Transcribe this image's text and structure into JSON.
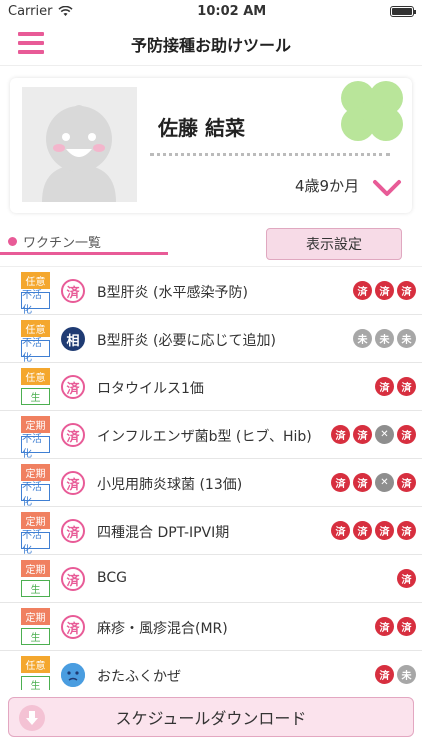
{
  "status": {
    "carrier": "Carrier",
    "time": "10:02 AM"
  },
  "nav": {
    "title": "予防接種お助けツール"
  },
  "profile": {
    "name": "佐藤 結菜",
    "age": "4歳9か月"
  },
  "section": {
    "label": "ワクチン一覧",
    "display_settings": "表示設定"
  },
  "vaccines": [
    {
      "tag1": "任意",
      "tag1_style": "orange",
      "tag2": "不活化",
      "tag2_style": "blue",
      "icon": "done-stamp-icon",
      "icon_glyph": "済",
      "icon_style": "pink",
      "name": "B型肝炎 (水平感染予防)",
      "doses": [
        {
          "text": "済",
          "state": "done"
        },
        {
          "text": "済",
          "state": "done"
        },
        {
          "text": "済",
          "state": "done"
        }
      ]
    },
    {
      "tag1": "任意",
      "tag1_style": "orange",
      "tag2": "不活化",
      "tag2_style": "blue",
      "icon": "consult-icon",
      "icon_glyph": "相",
      "icon_style": "navy",
      "name": "B型肝炎 (必要に応じて追加)",
      "doses": [
        {
          "text": "未",
          "state": "not"
        },
        {
          "text": "未",
          "state": "not"
        },
        {
          "text": "未",
          "state": "not"
        }
      ]
    },
    {
      "tag1": "任意",
      "tag1_style": "orange",
      "tag2": "生",
      "tag2_style": "green",
      "icon": "done-stamp-icon",
      "icon_glyph": "済",
      "icon_style": "pink",
      "name": "ロタウイルス1価",
      "doses": [
        {
          "text": "済",
          "state": "done"
        },
        {
          "text": "済",
          "state": "done"
        }
      ]
    },
    {
      "tag1": "定期",
      "tag1_style": "salmon",
      "tag2": "不活化",
      "tag2_style": "blue",
      "icon": "done-stamp-icon",
      "icon_glyph": "済",
      "icon_style": "pink",
      "name": "インフルエンザ菌b型 (ヒブ、Hib)",
      "doses": [
        {
          "text": "済",
          "state": "done"
        },
        {
          "text": "済",
          "state": "done"
        },
        {
          "text": "✕",
          "state": "x"
        },
        {
          "text": "済",
          "state": "done"
        }
      ]
    },
    {
      "tag1": "定期",
      "tag1_style": "salmon",
      "tag2": "不活化",
      "tag2_style": "blue",
      "icon": "done-stamp-icon",
      "icon_glyph": "済",
      "icon_style": "pink",
      "name": "小児用肺炎球菌 (13価)",
      "doses": [
        {
          "text": "済",
          "state": "done"
        },
        {
          "text": "済",
          "state": "done"
        },
        {
          "text": "✕",
          "state": "x"
        },
        {
          "text": "済",
          "state": "done"
        }
      ]
    },
    {
      "tag1": "定期",
      "tag1_style": "salmon",
      "tag2": "不活化",
      "tag2_style": "blue",
      "icon": "done-stamp-icon",
      "icon_glyph": "済",
      "icon_style": "pink",
      "name": "四種混合 DPT-IPVI期",
      "doses": [
        {
          "text": "済",
          "state": "done"
        },
        {
          "text": "済",
          "state": "done"
        },
        {
          "text": "済",
          "state": "done"
        },
        {
          "text": "済",
          "state": "done"
        }
      ]
    },
    {
      "tag1": "定期",
      "tag1_style": "salmon",
      "tag2": "生",
      "tag2_style": "green",
      "icon": "done-stamp-icon",
      "icon_glyph": "済",
      "icon_style": "pink",
      "name": "BCG",
      "doses": [
        {
          "text": "済",
          "state": "done"
        }
      ]
    },
    {
      "tag1": "定期",
      "tag1_style": "salmon",
      "tag2": "生",
      "tag2_style": "green",
      "icon": "done-stamp-icon",
      "icon_glyph": "済",
      "icon_style": "pink",
      "name": "麻疹・風疹混合(MR)",
      "doses": [
        {
          "text": "済",
          "state": "done"
        },
        {
          "text": "済",
          "state": "done"
        }
      ]
    },
    {
      "tag1": "任意",
      "tag1_style": "orange",
      "tag2": "生",
      "tag2_style": "green",
      "icon": "sad-face-icon",
      "icon_glyph": "",
      "icon_style": "blue",
      "name": "おたふくかぜ",
      "doses": [
        {
          "text": "済",
          "state": "done"
        },
        {
          "text": "未",
          "state": "not"
        }
      ]
    }
  ],
  "bottom": {
    "download_label": "スケジュールダウンロード"
  },
  "colors": {
    "accent": "#e85b97",
    "done": "#d72f3f",
    "not_done": "#a7a7a7"
  }
}
